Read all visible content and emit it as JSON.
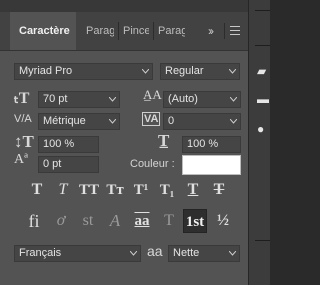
{
  "tabs": {
    "active": "Caractère",
    "t2": "Parag",
    "t3": "Pince",
    "t4": "Parag",
    "overflow_icon": "double-chevron-icon",
    "menu_icon": "hamburger-menu-icon"
  },
  "font": {
    "family": "Myriad Pro",
    "style": "Regular"
  },
  "size": {
    "value": "70 pt"
  },
  "leading": {
    "value": "(Auto)"
  },
  "kerning": {
    "value": "Métrique"
  },
  "tracking": {
    "value": "0"
  },
  "vscale": {
    "value": "100 %"
  },
  "hscale": {
    "value": "100 %"
  },
  "baseline": {
    "value": "0 pt"
  },
  "color": {
    "label": "Couleur :",
    "swatch": "#ffffff"
  },
  "style_buttons": {
    "bold": "T",
    "italic": "T",
    "caps": "TT",
    "smallcaps": "Tт",
    "super": "T¹",
    "sub": "T₁",
    "underline": "T",
    "strike": "T"
  },
  "opentype_buttons": {
    "ligature": "fi",
    "alt": "ơ",
    "swash": "st",
    "stylistic": "A",
    "titling": "aa",
    "ordinal": "T",
    "superscript_ord": "1st",
    "fraction": "½"
  },
  "language": {
    "value": "Français"
  },
  "antialias": {
    "icon_label": "aa",
    "value": "Nette"
  },
  "colors": {
    "panel": "#535353",
    "field": "#454545",
    "accent": "#ffffff"
  }
}
